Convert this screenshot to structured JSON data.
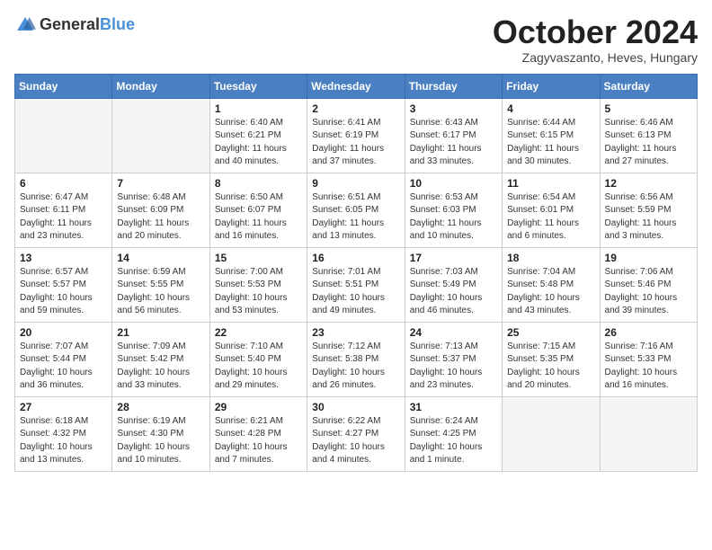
{
  "logo": {
    "general": "General",
    "blue": "Blue"
  },
  "header": {
    "month_year": "October 2024",
    "location": "Zagyvaszanto, Heves, Hungary"
  },
  "days_of_week": [
    "Sunday",
    "Monday",
    "Tuesday",
    "Wednesday",
    "Thursday",
    "Friday",
    "Saturday"
  ],
  "weeks": [
    [
      {
        "day": "",
        "info": ""
      },
      {
        "day": "",
        "info": ""
      },
      {
        "day": "1",
        "info": "Sunrise: 6:40 AM\nSunset: 6:21 PM\nDaylight: 11 hours and 40 minutes."
      },
      {
        "day": "2",
        "info": "Sunrise: 6:41 AM\nSunset: 6:19 PM\nDaylight: 11 hours and 37 minutes."
      },
      {
        "day": "3",
        "info": "Sunrise: 6:43 AM\nSunset: 6:17 PM\nDaylight: 11 hours and 33 minutes."
      },
      {
        "day": "4",
        "info": "Sunrise: 6:44 AM\nSunset: 6:15 PM\nDaylight: 11 hours and 30 minutes."
      },
      {
        "day": "5",
        "info": "Sunrise: 6:46 AM\nSunset: 6:13 PM\nDaylight: 11 hours and 27 minutes."
      }
    ],
    [
      {
        "day": "6",
        "info": "Sunrise: 6:47 AM\nSunset: 6:11 PM\nDaylight: 11 hours and 23 minutes."
      },
      {
        "day": "7",
        "info": "Sunrise: 6:48 AM\nSunset: 6:09 PM\nDaylight: 11 hours and 20 minutes."
      },
      {
        "day": "8",
        "info": "Sunrise: 6:50 AM\nSunset: 6:07 PM\nDaylight: 11 hours and 16 minutes."
      },
      {
        "day": "9",
        "info": "Sunrise: 6:51 AM\nSunset: 6:05 PM\nDaylight: 11 hours and 13 minutes."
      },
      {
        "day": "10",
        "info": "Sunrise: 6:53 AM\nSunset: 6:03 PM\nDaylight: 11 hours and 10 minutes."
      },
      {
        "day": "11",
        "info": "Sunrise: 6:54 AM\nSunset: 6:01 PM\nDaylight: 11 hours and 6 minutes."
      },
      {
        "day": "12",
        "info": "Sunrise: 6:56 AM\nSunset: 5:59 PM\nDaylight: 11 hours and 3 minutes."
      }
    ],
    [
      {
        "day": "13",
        "info": "Sunrise: 6:57 AM\nSunset: 5:57 PM\nDaylight: 10 hours and 59 minutes."
      },
      {
        "day": "14",
        "info": "Sunrise: 6:59 AM\nSunset: 5:55 PM\nDaylight: 10 hours and 56 minutes."
      },
      {
        "day": "15",
        "info": "Sunrise: 7:00 AM\nSunset: 5:53 PM\nDaylight: 10 hours and 53 minutes."
      },
      {
        "day": "16",
        "info": "Sunrise: 7:01 AM\nSunset: 5:51 PM\nDaylight: 10 hours and 49 minutes."
      },
      {
        "day": "17",
        "info": "Sunrise: 7:03 AM\nSunset: 5:49 PM\nDaylight: 10 hours and 46 minutes."
      },
      {
        "day": "18",
        "info": "Sunrise: 7:04 AM\nSunset: 5:48 PM\nDaylight: 10 hours and 43 minutes."
      },
      {
        "day": "19",
        "info": "Sunrise: 7:06 AM\nSunset: 5:46 PM\nDaylight: 10 hours and 39 minutes."
      }
    ],
    [
      {
        "day": "20",
        "info": "Sunrise: 7:07 AM\nSunset: 5:44 PM\nDaylight: 10 hours and 36 minutes."
      },
      {
        "day": "21",
        "info": "Sunrise: 7:09 AM\nSunset: 5:42 PM\nDaylight: 10 hours and 33 minutes."
      },
      {
        "day": "22",
        "info": "Sunrise: 7:10 AM\nSunset: 5:40 PM\nDaylight: 10 hours and 29 minutes."
      },
      {
        "day": "23",
        "info": "Sunrise: 7:12 AM\nSunset: 5:38 PM\nDaylight: 10 hours and 26 minutes."
      },
      {
        "day": "24",
        "info": "Sunrise: 7:13 AM\nSunset: 5:37 PM\nDaylight: 10 hours and 23 minutes."
      },
      {
        "day": "25",
        "info": "Sunrise: 7:15 AM\nSunset: 5:35 PM\nDaylight: 10 hours and 20 minutes."
      },
      {
        "day": "26",
        "info": "Sunrise: 7:16 AM\nSunset: 5:33 PM\nDaylight: 10 hours and 16 minutes."
      }
    ],
    [
      {
        "day": "27",
        "info": "Sunrise: 6:18 AM\nSunset: 4:32 PM\nDaylight: 10 hours and 13 minutes."
      },
      {
        "day": "28",
        "info": "Sunrise: 6:19 AM\nSunset: 4:30 PM\nDaylight: 10 hours and 10 minutes."
      },
      {
        "day": "29",
        "info": "Sunrise: 6:21 AM\nSunset: 4:28 PM\nDaylight: 10 hours and 7 minutes."
      },
      {
        "day": "30",
        "info": "Sunrise: 6:22 AM\nSunset: 4:27 PM\nDaylight: 10 hours and 4 minutes."
      },
      {
        "day": "31",
        "info": "Sunrise: 6:24 AM\nSunset: 4:25 PM\nDaylight: 10 hours and 1 minute."
      },
      {
        "day": "",
        "info": ""
      },
      {
        "day": "",
        "info": ""
      }
    ]
  ]
}
